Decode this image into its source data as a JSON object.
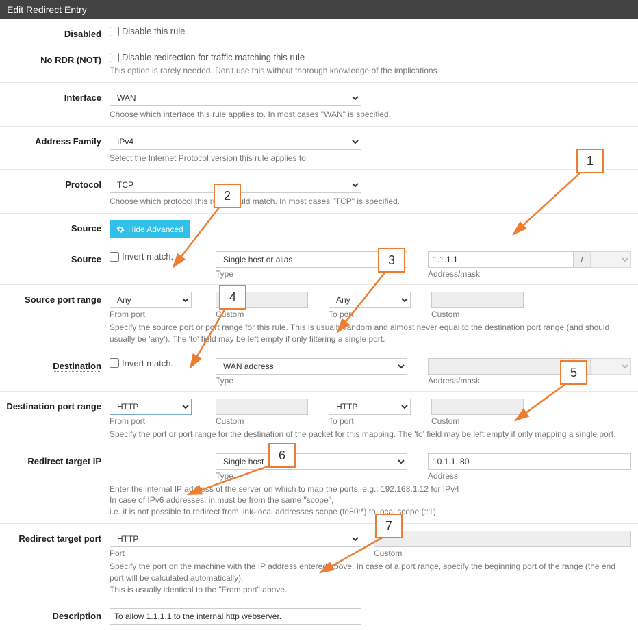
{
  "panel": {
    "title": "Edit Redirect Entry"
  },
  "disabled": {
    "label": "Disabled",
    "checkbox": "Disable this rule"
  },
  "no_rdr": {
    "label": "No RDR (NOT)",
    "checkbox": "Disable redirection for traffic matching this rule",
    "help": "This option is rarely needed. Don't use this without thorough knowledge of the implications."
  },
  "interface": {
    "label": "Interface",
    "value": "WAN",
    "help": "Choose which interface this rule applies to. In most cases \"WAN\" is specified."
  },
  "address_family": {
    "label": "Address Family",
    "value": "IPv4",
    "help": "Select the Internet Protocol version this rule applies to."
  },
  "protocol": {
    "label": "Protocol",
    "value": "TCP",
    "help": "Choose which protocol this rule should match. In most cases \"TCP\" is specified."
  },
  "source_btn": {
    "label": "Source",
    "button": "Hide Advanced"
  },
  "source": {
    "label": "Source",
    "invert": "Invert match.",
    "type_label": "Type",
    "type_value": "Single host or alias",
    "addr_label": "Address/mask",
    "addr_value": "1.1.1.1",
    "slash": "/",
    "mask_value": ""
  },
  "src_port": {
    "label": "Source port range",
    "from_label": "From port",
    "from_value": "Any",
    "to_label": "To port",
    "to_value": "Any",
    "custom_label": "Custom",
    "help": "Specify the source port or port range for this rule. This is usually random and almost never equal to the destination port range (and should usually be 'any'). The 'to' field may be left empty if only filtering a single port."
  },
  "destination": {
    "label": "Destination",
    "invert": "Invert match.",
    "type_label": "Type",
    "type_value": "WAN address",
    "addr_label": "Address/mask",
    "addr_value": "",
    "slash": "/",
    "mask_value": ""
  },
  "dst_port": {
    "label": "Destination port range",
    "from_label": "From port",
    "from_value": "HTTP",
    "to_label": "To port",
    "to_value": "HTTP",
    "custom_label": "Custom",
    "help": "Specify the port or port range for the destination of the packet for this mapping. The 'to' field may be left empty if only mapping a single port."
  },
  "redir_ip": {
    "label": "Redirect target IP",
    "type_label": "Type",
    "type_value": "Single host",
    "addr_label": "Address",
    "addr_value": "10.1.1..80",
    "help1": "Enter the internal IP address of the server on which to map the ports. e.g.: 192.168.1.12 for IPv4",
    "help2": "In case of IPv6 addresses, in must be from the same \"scope\",",
    "help3": "i.e. it is not possible to redirect from link-local addresses scope (fe80:*) to local scope (::1)"
  },
  "redir_port": {
    "label": "Redirect target port",
    "port_label": "Port",
    "port_value": "HTTP",
    "custom_label": "Custom",
    "help1": "Specify the port on the machine with the IP address entered above. In case of a port range, specify the beginning port of the range (the end port will be calculated automatically).",
    "help2": "This is usually identical to the \"From port\" above."
  },
  "description": {
    "label": "Description",
    "value": "To allow 1.1.1.1 to the internal http webserver."
  },
  "annotations": {
    "n1": "1",
    "n2": "2",
    "n3": "3",
    "n4": "4",
    "n5": "5",
    "n6": "6",
    "n7": "7"
  }
}
